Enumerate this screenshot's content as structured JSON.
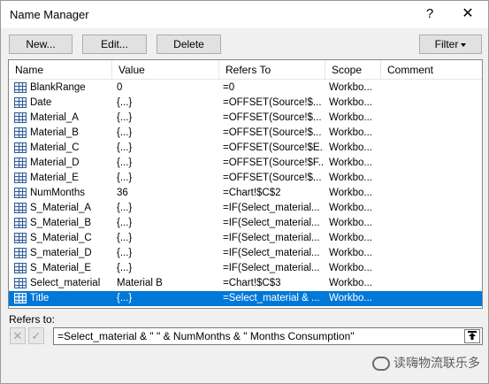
{
  "window": {
    "title": "Name Manager",
    "help": "?",
    "close": "✕"
  },
  "toolbar": {
    "new_label": "New...",
    "edit_label": "Edit...",
    "delete_label": "Delete",
    "filter_label": "Filter"
  },
  "list": {
    "columns": [
      "Name",
      "Value",
      "Refers To",
      "Scope",
      "Comment"
    ],
    "rows": [
      {
        "name": "BlankRange",
        "value": "0",
        "refers": "=0",
        "scope": "Workbo...",
        "comment": ""
      },
      {
        "name": "Date",
        "value": "{...}",
        "refers": "=OFFSET(Source!$...",
        "scope": "Workbo...",
        "comment": ""
      },
      {
        "name": "Material_A",
        "value": "{...}",
        "refers": "=OFFSET(Source!$...",
        "scope": "Workbo...",
        "comment": ""
      },
      {
        "name": "Material_B",
        "value": "{...}",
        "refers": "=OFFSET(Source!$...",
        "scope": "Workbo...",
        "comment": ""
      },
      {
        "name": "Material_C",
        "value": "{...}",
        "refers": "=OFFSET(Source!$E...",
        "scope": "Workbo...",
        "comment": ""
      },
      {
        "name": "Material_D",
        "value": "{...}",
        "refers": "=OFFSET(Source!$F...",
        "scope": "Workbo...",
        "comment": ""
      },
      {
        "name": "Material_E",
        "value": "{...}",
        "refers": "=OFFSET(Source!$...",
        "scope": "Workbo...",
        "comment": ""
      },
      {
        "name": "NumMonths",
        "value": "36",
        "refers": "=Chart!$C$2",
        "scope": "Workbo...",
        "comment": ""
      },
      {
        "name": "S_Material_A",
        "value": "{...}",
        "refers": "=IF(Select_material...",
        "scope": "Workbo...",
        "comment": ""
      },
      {
        "name": "S_Material_B",
        "value": "{...}",
        "refers": "=IF(Select_material...",
        "scope": "Workbo...",
        "comment": ""
      },
      {
        "name": "S_Material_C",
        "value": "{...}",
        "refers": "=IF(Select_material...",
        "scope": "Workbo...",
        "comment": ""
      },
      {
        "name": "S_material_D",
        "value": "{...}",
        "refers": "=IF(Select_material...",
        "scope": "Workbo...",
        "comment": ""
      },
      {
        "name": "S_Material_E",
        "value": "{...}",
        "refers": "=IF(Select_material...",
        "scope": "Workbo...",
        "comment": ""
      },
      {
        "name": "Select_material",
        "value": "Material B",
        "refers": "=Chart!$C$3",
        "scope": "Workbo...",
        "comment": ""
      },
      {
        "name": "Title",
        "value": "{...}",
        "refers": "=Select_material & ...",
        "scope": "Workbo...",
        "comment": ""
      }
    ],
    "selected_index": 14
  },
  "refers_to": {
    "label": "Refers to:",
    "value": "=Select_material & \" \" & NumMonths & \" Months Consumption\"",
    "cancel_icon": "✕",
    "confirm_icon": "✓",
    "collapse_icon": "collapse-dialog-icon"
  },
  "watermark": {
    "text": "读嗨物流联乐多"
  }
}
